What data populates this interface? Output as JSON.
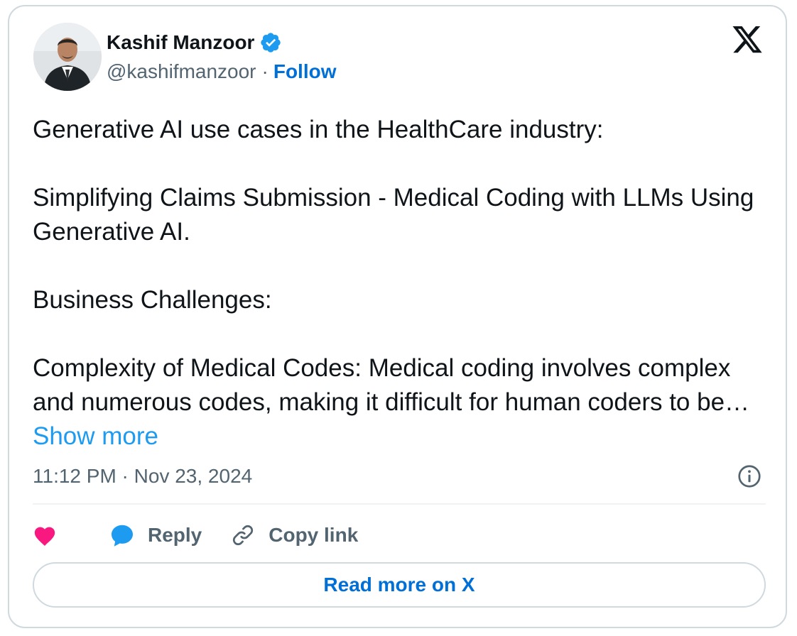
{
  "author": {
    "name": "Kashif Manzoor",
    "handle": "@kashifmanzoor",
    "separator": "·",
    "follow_label": "Follow",
    "verified": true
  },
  "platform_icon": "x-logo-icon",
  "tweet": {
    "lines": [
      "Generative AI use cases in the HealthCare industry:",
      "Simplifying Claims Submission - Medical Coding with LLMs Using Generative AI.",
      "Business Challenges:",
      "Complexity of Medical Codes: Medical coding involves complex and numerous codes, making it difficult for human coders to be…"
    ],
    "show_more_label": "Show more",
    "timestamp": "11:12 PM · Nov 23, 2024"
  },
  "actions": {
    "like_icon": "heart-icon",
    "reply_label": "Reply",
    "copy_link_label": "Copy link"
  },
  "read_more_label": "Read more on X",
  "colors": {
    "accent": "#1d9bf0",
    "link_dark": "#006fd6",
    "like": "#f91880",
    "muted": "#536471",
    "text": "#0f1419",
    "border": "#cfd9de"
  }
}
